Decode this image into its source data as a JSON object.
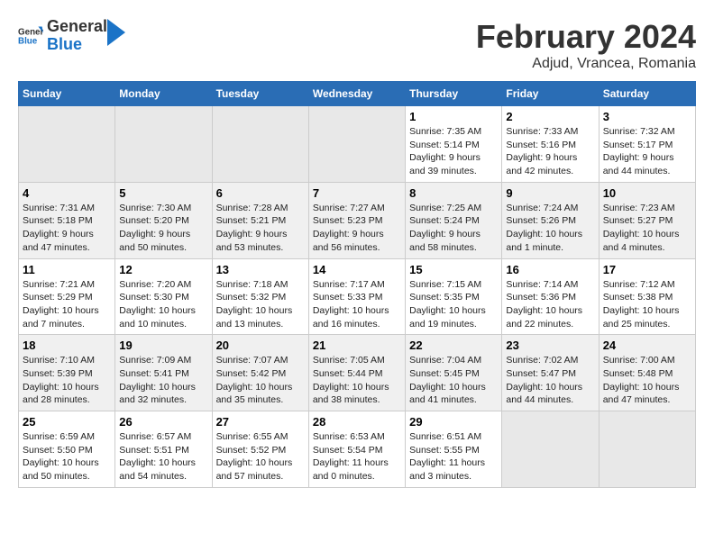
{
  "header": {
    "logo_general": "General",
    "logo_blue": "Blue",
    "main_title": "February 2024",
    "subtitle": "Adjud, Vrancea, Romania"
  },
  "calendar": {
    "days_of_week": [
      "Sunday",
      "Monday",
      "Tuesday",
      "Wednesday",
      "Thursday",
      "Friday",
      "Saturday"
    ],
    "weeks": [
      [
        {
          "day": "",
          "info": ""
        },
        {
          "day": "",
          "info": ""
        },
        {
          "day": "",
          "info": ""
        },
        {
          "day": "",
          "info": ""
        },
        {
          "day": "1",
          "info": "Sunrise: 7:35 AM\nSunset: 5:14 PM\nDaylight: 9 hours and 39 minutes."
        },
        {
          "day": "2",
          "info": "Sunrise: 7:33 AM\nSunset: 5:16 PM\nDaylight: 9 hours and 42 minutes."
        },
        {
          "day": "3",
          "info": "Sunrise: 7:32 AM\nSunset: 5:17 PM\nDaylight: 9 hours and 44 minutes."
        }
      ],
      [
        {
          "day": "4",
          "info": "Sunrise: 7:31 AM\nSunset: 5:18 PM\nDaylight: 9 hours and 47 minutes."
        },
        {
          "day": "5",
          "info": "Sunrise: 7:30 AM\nSunset: 5:20 PM\nDaylight: 9 hours and 50 minutes."
        },
        {
          "day": "6",
          "info": "Sunrise: 7:28 AM\nSunset: 5:21 PM\nDaylight: 9 hours and 53 minutes."
        },
        {
          "day": "7",
          "info": "Sunrise: 7:27 AM\nSunset: 5:23 PM\nDaylight: 9 hours and 56 minutes."
        },
        {
          "day": "8",
          "info": "Sunrise: 7:25 AM\nSunset: 5:24 PM\nDaylight: 9 hours and 58 minutes."
        },
        {
          "day": "9",
          "info": "Sunrise: 7:24 AM\nSunset: 5:26 PM\nDaylight: 10 hours and 1 minute."
        },
        {
          "day": "10",
          "info": "Sunrise: 7:23 AM\nSunset: 5:27 PM\nDaylight: 10 hours and 4 minutes."
        }
      ],
      [
        {
          "day": "11",
          "info": "Sunrise: 7:21 AM\nSunset: 5:29 PM\nDaylight: 10 hours and 7 minutes."
        },
        {
          "day": "12",
          "info": "Sunrise: 7:20 AM\nSunset: 5:30 PM\nDaylight: 10 hours and 10 minutes."
        },
        {
          "day": "13",
          "info": "Sunrise: 7:18 AM\nSunset: 5:32 PM\nDaylight: 10 hours and 13 minutes."
        },
        {
          "day": "14",
          "info": "Sunrise: 7:17 AM\nSunset: 5:33 PM\nDaylight: 10 hours and 16 minutes."
        },
        {
          "day": "15",
          "info": "Sunrise: 7:15 AM\nSunset: 5:35 PM\nDaylight: 10 hours and 19 minutes."
        },
        {
          "day": "16",
          "info": "Sunrise: 7:14 AM\nSunset: 5:36 PM\nDaylight: 10 hours and 22 minutes."
        },
        {
          "day": "17",
          "info": "Sunrise: 7:12 AM\nSunset: 5:38 PM\nDaylight: 10 hours and 25 minutes."
        }
      ],
      [
        {
          "day": "18",
          "info": "Sunrise: 7:10 AM\nSunset: 5:39 PM\nDaylight: 10 hours and 28 minutes."
        },
        {
          "day": "19",
          "info": "Sunrise: 7:09 AM\nSunset: 5:41 PM\nDaylight: 10 hours and 32 minutes."
        },
        {
          "day": "20",
          "info": "Sunrise: 7:07 AM\nSunset: 5:42 PM\nDaylight: 10 hours and 35 minutes."
        },
        {
          "day": "21",
          "info": "Sunrise: 7:05 AM\nSunset: 5:44 PM\nDaylight: 10 hours and 38 minutes."
        },
        {
          "day": "22",
          "info": "Sunrise: 7:04 AM\nSunset: 5:45 PM\nDaylight: 10 hours and 41 minutes."
        },
        {
          "day": "23",
          "info": "Sunrise: 7:02 AM\nSunset: 5:47 PM\nDaylight: 10 hours and 44 minutes."
        },
        {
          "day": "24",
          "info": "Sunrise: 7:00 AM\nSunset: 5:48 PM\nDaylight: 10 hours and 47 minutes."
        }
      ],
      [
        {
          "day": "25",
          "info": "Sunrise: 6:59 AM\nSunset: 5:50 PM\nDaylight: 10 hours and 50 minutes."
        },
        {
          "day": "26",
          "info": "Sunrise: 6:57 AM\nSunset: 5:51 PM\nDaylight: 10 hours and 54 minutes."
        },
        {
          "day": "27",
          "info": "Sunrise: 6:55 AM\nSunset: 5:52 PM\nDaylight: 10 hours and 57 minutes."
        },
        {
          "day": "28",
          "info": "Sunrise: 6:53 AM\nSunset: 5:54 PM\nDaylight: 11 hours and 0 minutes."
        },
        {
          "day": "29",
          "info": "Sunrise: 6:51 AM\nSunset: 5:55 PM\nDaylight: 11 hours and 3 minutes."
        },
        {
          "day": "",
          "info": ""
        },
        {
          "day": "",
          "info": ""
        }
      ]
    ]
  }
}
